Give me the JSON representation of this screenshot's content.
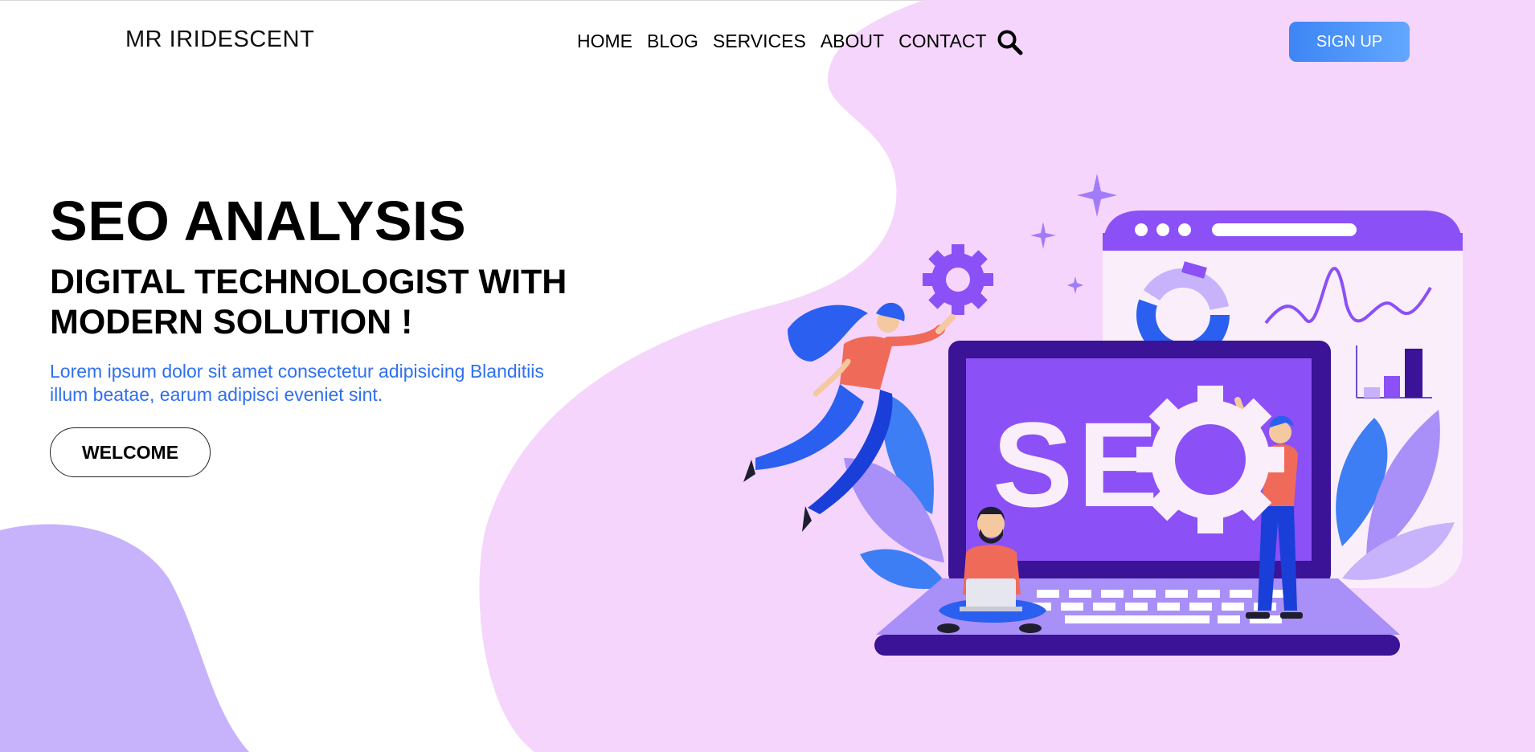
{
  "header": {
    "logo": "MR IRIDESCENT",
    "nav": [
      "HOME",
      "BLOG",
      "SERVICES",
      "ABOUT",
      "CONTACT"
    ],
    "search_icon": "search-icon",
    "signup_label": "SIGN UP"
  },
  "hero": {
    "title": "SEO ANALYSIS",
    "subtitle": "DIGITAL TECHNOLOGIST WITH MODERN SOLUTION !",
    "description": "Lorem ipsum dolor sit amet consectetur adipisicing Blanditiis illum beatae, earum adipisci eveniet sint.",
    "button_label": "WELCOME"
  },
  "illustration": {
    "laptop_text": "SEO"
  },
  "colors": {
    "blob_pink": "#f5d5fb",
    "blob_lavender": "#c7b3fb",
    "accent_blue": "#3d85f4",
    "text_blue": "#2f6ff0",
    "purple": "#8b50f6",
    "dark_purple": "#3a1396"
  }
}
